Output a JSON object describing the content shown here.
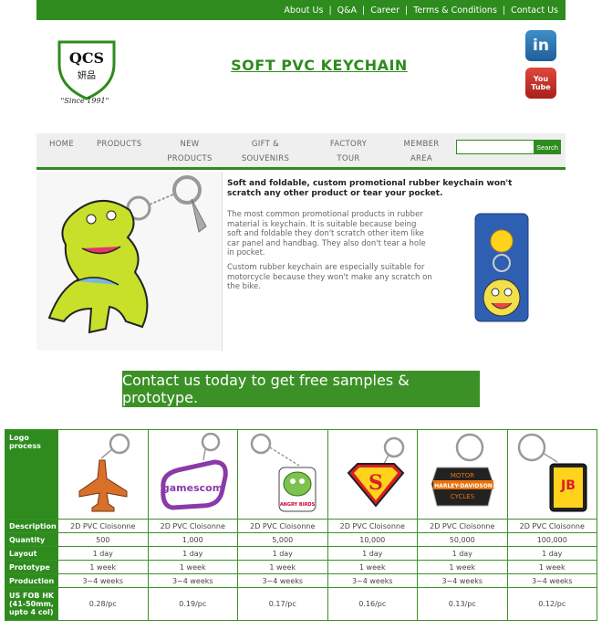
{
  "topnav": {
    "items": [
      "About Us",
      "Q&A",
      "Career",
      "Terms & Conditions",
      "Contact Us"
    ]
  },
  "logo": {
    "text": "QCS",
    "chinese": "妍品",
    "since": "\"Since 1991\""
  },
  "site_title": "SOFT PVC KEYCHAIN",
  "social": {
    "linkedin": "in",
    "youtube_line1": "You",
    "youtube_line2": "Tube"
  },
  "nav": {
    "home": "HOME",
    "products": "PRODUCTS",
    "new_line1": "NEW",
    "new_line2": "PRODUCTS",
    "gift_line1": "GIFT &",
    "gift_line2": "SOUVENIRS",
    "factory_line1": "FACTORY",
    "factory_line2": "TOUR",
    "member_line1": "MEMBER",
    "member_line2": "AREA",
    "search_placeholder": "",
    "search_button": "Search"
  },
  "intro": {
    "headline": "Soft and foldable, custom promotional rubber keychain won't scratch any other product or tear your pocket.",
    "para1": "The most common promotional products in rubber material is keychain. It is suitable because being soft and foldable they don't scratch other item like car panel and handbag. They also don't tear a hole in pocket.",
    "para2": "Custom rubber keychain are especially suitable for motorcycle because they won't make any scratch on the bike."
  },
  "cta": "Contact us today to get free samples & prototype.",
  "table": {
    "row_headers": {
      "logo_process_1": "Logo",
      "logo_process_2": "process",
      "description": "Description",
      "quantity": "Quantity",
      "layout": "Layout",
      "prototype": "Prototype",
      "production": "Production",
      "fob_1": "US FOB HK",
      "fob_2": "(41-50mm,",
      "fob_3": "upto 4 col)"
    },
    "columns": [
      {
        "description": "2D PVC Cloisonne",
        "quantity": "500",
        "layout": "1 day",
        "prototype": "1 week",
        "production": "3~4 weeks",
        "fob": "0.28/pc"
      },
      {
        "description": "2D PVC Cloisonne",
        "quantity": "1,000",
        "layout": "1 day",
        "prototype": "1 week",
        "production": "3~4 weeks",
        "fob": "0.19/pc",
        "logo_text": "gamescom"
      },
      {
        "description": "2D PVC Cloisonne",
        "quantity": "5,000",
        "layout": "1 day",
        "prototype": "1 week",
        "production": "3~4 weeks",
        "fob": "0.17/pc",
        "logo_text": "ANGRY BIRDS"
      },
      {
        "description": "2D PVC Cloisonne",
        "quantity": "10,000",
        "layout": "1 day",
        "prototype": "1 week",
        "production": "3~4 weeks",
        "fob": "0.16/pc",
        "logo_text": "S"
      },
      {
        "description": "2D PVC Cloisonne",
        "quantity": "50,000",
        "layout": "1 day",
        "prototype": "1 week",
        "production": "3~4 weeks",
        "fob": "0.13/pc",
        "logo_text_1": "MOTOR",
        "logo_text_2": "HARLEY-DAVIDSON",
        "logo_text_3": "CYCLES"
      },
      {
        "description": "2D PVC Cloisonne",
        "quantity": "100,000",
        "layout": "1 day",
        "prototype": "1 week",
        "production": "3~4 weeks",
        "fob": "0.12/pc",
        "logo_text": "JB"
      }
    ]
  }
}
